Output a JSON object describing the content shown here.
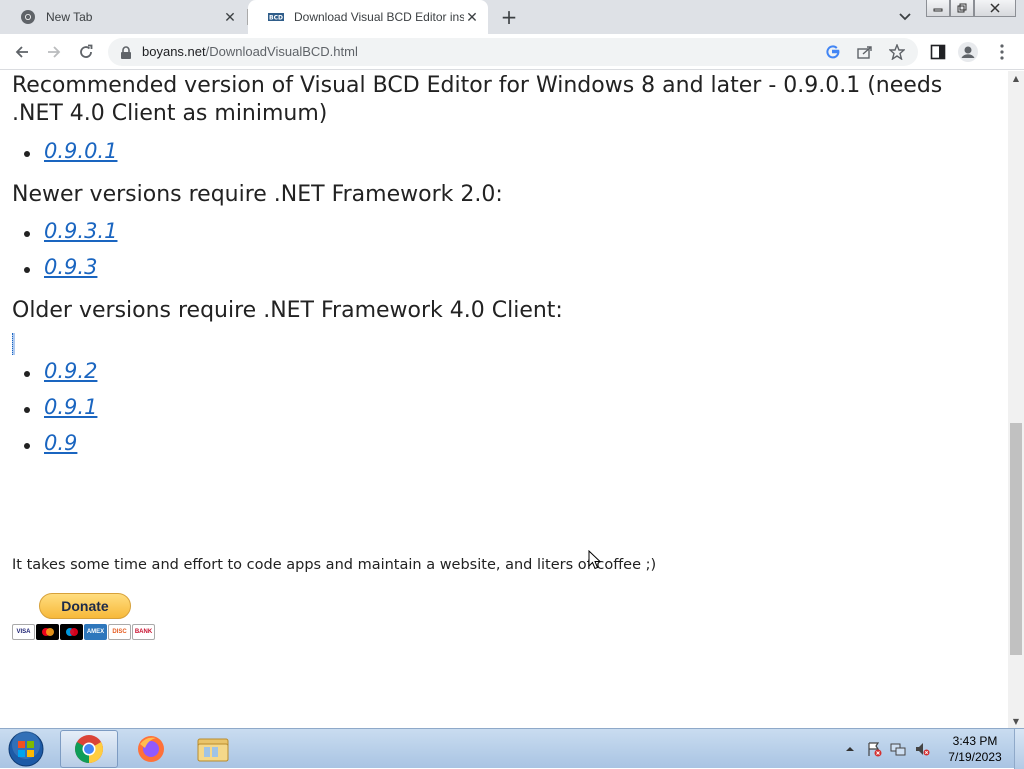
{
  "browser": {
    "tabs": [
      {
        "title": "New Tab",
        "active": false,
        "icon": "chrome-icon"
      },
      {
        "title": "Download Visual BCD Editor inst",
        "active": true,
        "icon": "site-favicon"
      }
    ],
    "url_host": "boyans.net",
    "url_path": "/DownloadVisualBCD.html"
  },
  "page": {
    "heading_recommended": "Recommended version of Visual BCD Editor for Windows 8 and later - 0.9.0.1 (needs .NET 4.0 Client as minimum)",
    "recommended_links": [
      "0.9.0.1"
    ],
    "heading_newer": "Newer versions require .NET Framework 2.0:",
    "newer_links": [
      "0.9.3.1",
      "0.9.3"
    ],
    "heading_older": "Older versions require .NET Framework 4.0 Client:",
    "older_links": [
      "0.9.2",
      "0.9.1",
      "0.9"
    ],
    "support_text": "It takes some time and effort to code apps and maintain a website, and liters of coffee ;)",
    "donate_label": "Donate",
    "cards": [
      "VISA",
      "MC",
      "MC",
      "AMEX",
      "DISC",
      "BANK"
    ]
  },
  "taskbar": {
    "apps": [
      "chrome-icon",
      "firefox-icon",
      "explorer-icon"
    ],
    "time": "3:43 PM",
    "date": "7/19/2023"
  },
  "colors": {
    "link": "#1a65c0",
    "tabstrip": "#dee1e6",
    "taskbar": "#b4cde8"
  }
}
